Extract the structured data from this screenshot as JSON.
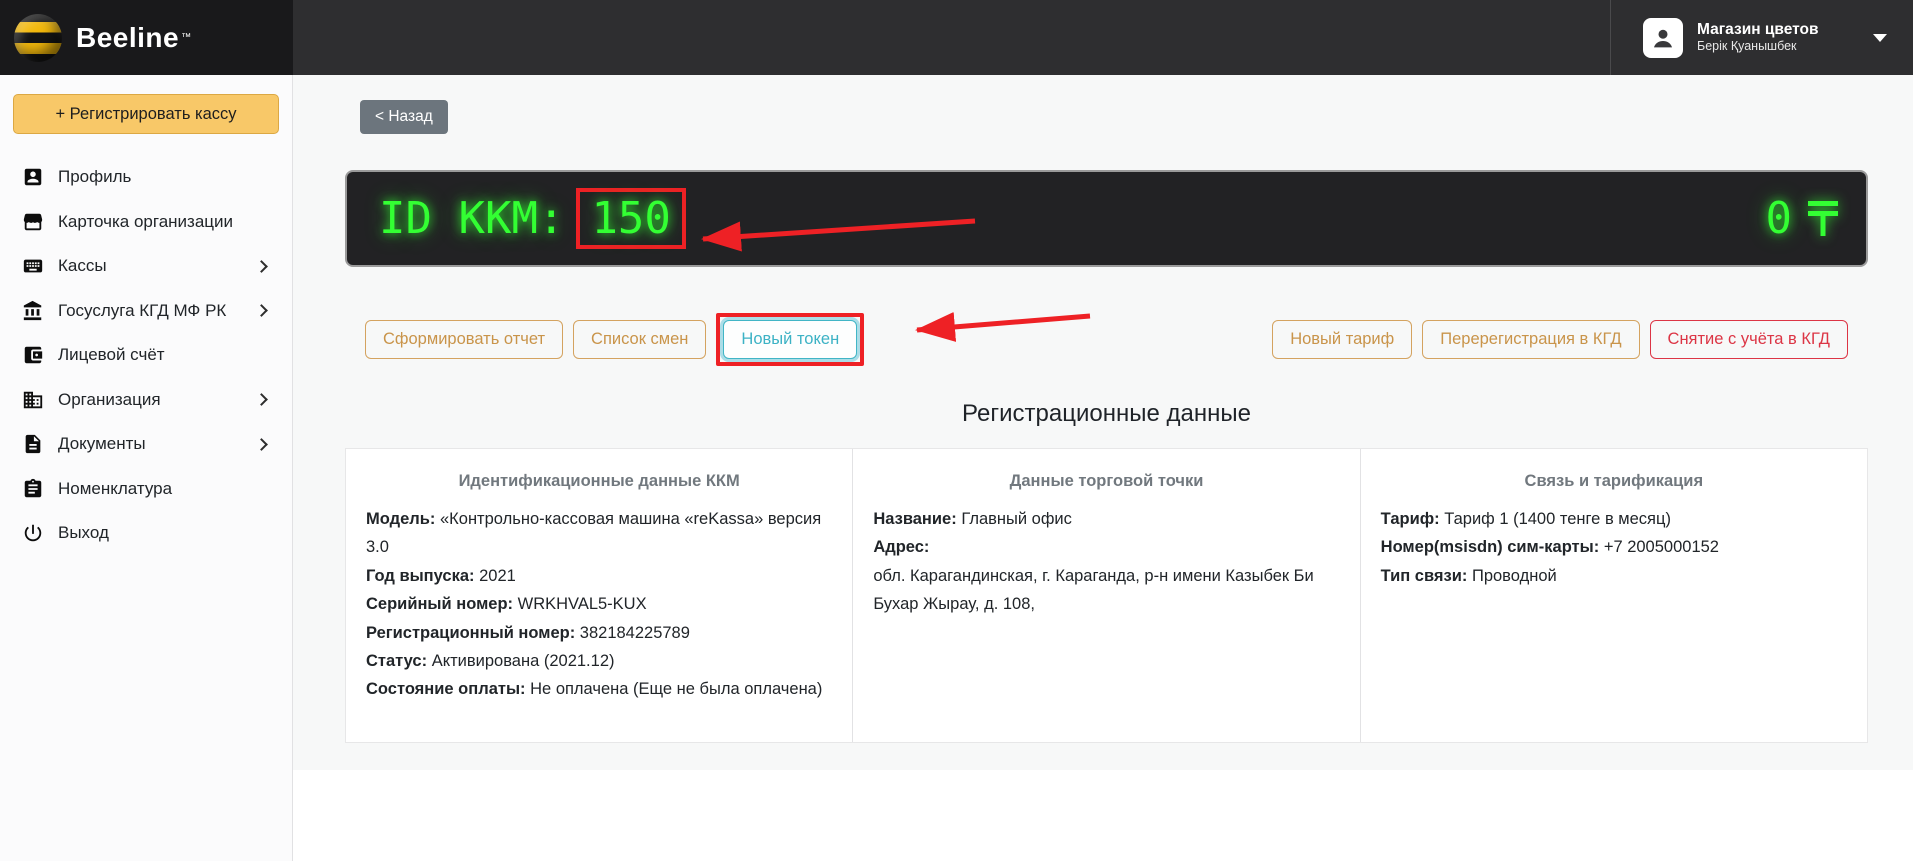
{
  "header": {
    "brand": {
      "name": "Beeline",
      "tm": "™"
    },
    "user": {
      "store": "Магазин цветов",
      "person": "Берік Қуанышбек"
    }
  },
  "sidebar": {
    "register_button": "+ Регистрировать кассу",
    "items": [
      {
        "icon": "profile-badge-icon",
        "label": "Профиль",
        "chevron": false
      },
      {
        "icon": "storefront-icon",
        "label": "Карточка организации",
        "chevron": false
      },
      {
        "icon": "keyboard-icon",
        "label": "Кассы",
        "chevron": true
      },
      {
        "icon": "bank-icon",
        "label": "Госуслуга КГД МФ РК",
        "chevron": true
      },
      {
        "icon": "wallet-icon",
        "label": "Лицевой счёт",
        "chevron": false
      },
      {
        "icon": "building-icon",
        "label": "Организация",
        "chevron": true
      },
      {
        "icon": "document-icon",
        "label": "Документы",
        "chevron": true
      },
      {
        "icon": "clipboard-icon",
        "label": "Номенклатура",
        "chevron": false
      },
      {
        "icon": "power-icon",
        "label": "Выход",
        "chevron": false
      }
    ]
  },
  "main": {
    "back_button": "< Назад",
    "display": {
      "id_label": "ID KKM:",
      "id_value": "150",
      "balance_value": "0",
      "currency_symbol": "₸"
    },
    "actions_left": [
      "Сформировать отчет",
      "Список смен",
      "Новый токен"
    ],
    "actions_right": [
      "Новый тариф",
      "Перерегистрация в КГД",
      "Снятие с учёта в КГД"
    ],
    "section_title": "Регистрационные данные",
    "panels": [
      {
        "title": "Идентификационные данные ККМ",
        "rows": [
          {
            "label": "Модель:",
            "value": "«Контрольно-кассовая машина «reKassa» версия 3.0"
          },
          {
            "label": "Год выпуска:",
            "value": "2021"
          },
          {
            "label": "Серийный номер:",
            "value": "WRKHVAL5-KUX"
          },
          {
            "label": "Регистрационный номер:",
            "value": "382184225789"
          },
          {
            "label": "Статус:",
            "value": "Активирована (2021.12)"
          },
          {
            "label": "Состояние оплаты:",
            "value": "Не оплачена (Еще не была оплачена)"
          }
        ]
      },
      {
        "title": "Данные торговой точки",
        "rows": [
          {
            "label": "Название:",
            "value": "Главный офис"
          },
          {
            "label": "Адрес:",
            "value": ""
          },
          {
            "label": "",
            "value": "обл. Карагандинская, г. Караганда, р-н имени Казыбек Би"
          },
          {
            "label": "",
            "value": "Бухар Жырау, д. 108,"
          }
        ]
      },
      {
        "title": "Связь и тарификация",
        "rows": [
          {
            "label": "Тариф:",
            "value": "Тариф 1 (1400 тенге в месяц)"
          },
          {
            "label": "Номер(msisdn) сим-карты:",
            "value": "+7 2005000152"
          },
          {
            "label": "Тип связи:",
            "value": "Проводной"
          }
        ]
      }
    ]
  },
  "colors": {
    "brand_yellow": "#f2b80c",
    "sidebar_button_yellow": "#f8c868",
    "display_green": "#33ff33",
    "annotation_red": "#ee2125",
    "outline_orange": "#d4a360",
    "info_cyan": "#41b5c6",
    "danger_red": "#dc3545",
    "back_gray": "#6c757d"
  }
}
